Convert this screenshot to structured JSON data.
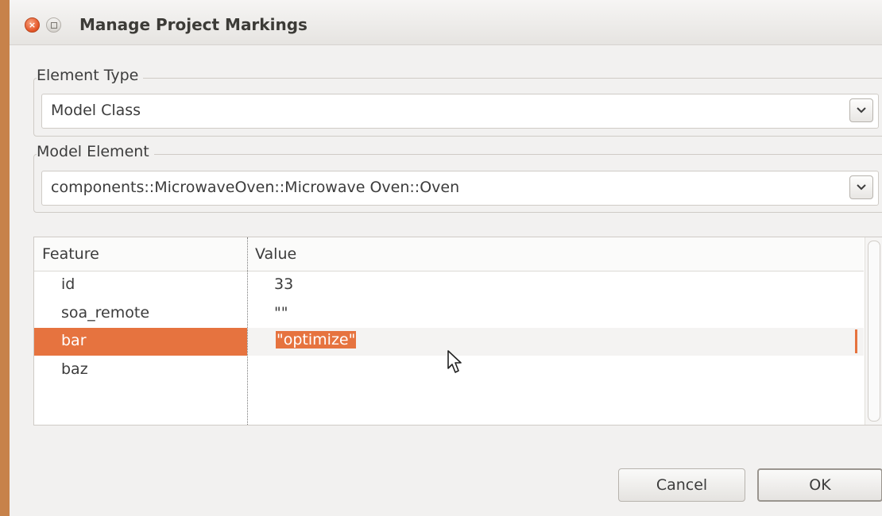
{
  "window": {
    "title": "Manage Project Markings",
    "close_glyph": "×"
  },
  "element_type": {
    "label": "Element Type",
    "selected": "Model Class"
  },
  "model_element": {
    "label": "Model Element",
    "selected": "components::MicrowaveOven::Microwave Oven::Oven"
  },
  "table": {
    "headers": [
      "Feature",
      "Value"
    ],
    "rows": [
      {
        "feature": "id",
        "value": "33"
      },
      {
        "feature": "soa_remote",
        "value": "\"\""
      },
      {
        "feature": "bar",
        "value": "\"optimize\"",
        "selected": true,
        "editing": true
      },
      {
        "feature": "baz",
        "value": ""
      }
    ]
  },
  "buttons": {
    "cancel": "Cancel",
    "ok": "OK"
  },
  "colors": {
    "accent": "#e6733f",
    "background": "#f2f1f0"
  }
}
